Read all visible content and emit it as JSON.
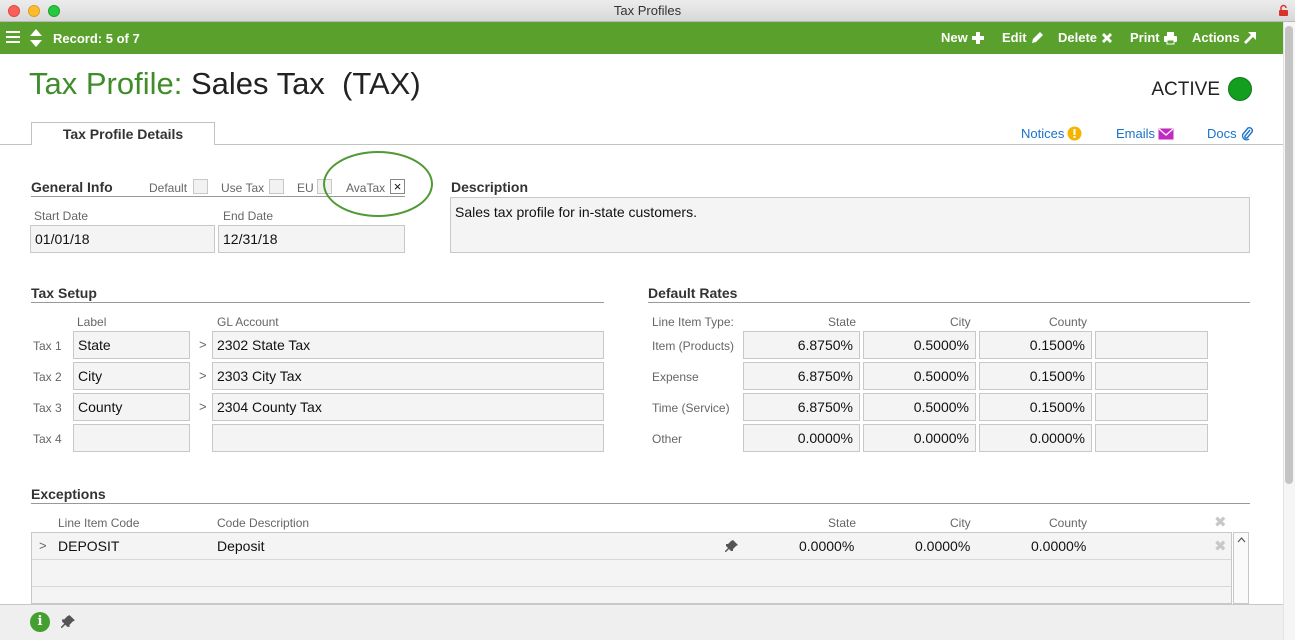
{
  "window": {
    "title": "Tax Profiles"
  },
  "toolbar": {
    "record": "Record: 5 of 7",
    "buttons": [
      {
        "label": "New",
        "icon": "plus-icon"
      },
      {
        "label": "Edit",
        "icon": "pencil-icon"
      },
      {
        "label": "Delete",
        "icon": "x-icon"
      },
      {
        "label": "Print",
        "icon": "printer-icon"
      },
      {
        "label": "Actions",
        "icon": "arrow-up-right-icon"
      }
    ]
  },
  "header": {
    "title_prefix": "Tax Profile:",
    "title": "Sales Tax  (TAX)",
    "status": "ACTIVE",
    "status_color": "#139e20"
  },
  "tabs": {
    "details": "Tax Profile Details"
  },
  "toplinks": {
    "notices": "Notices",
    "emails": "Emails",
    "docs": "Docs"
  },
  "general_info": {
    "heading": "General Info",
    "default_label": "Default",
    "default_checked": false,
    "use_tax_label": "Use Tax",
    "use_tax_checked": false,
    "eu_label": "EU",
    "eu_checked": false,
    "avatax_label": "AvaTax",
    "avatax_mark": "×",
    "start_date_label": "Start Date",
    "start_date": "01/01/18",
    "end_date_label": "End Date",
    "end_date": "12/31/18"
  },
  "description": {
    "heading": "Description",
    "text": "Sales tax profile for in-state customers."
  },
  "tax_setup": {
    "heading": "Tax Setup",
    "col_label": "Label",
    "col_gl": "GL Account",
    "rows": [
      {
        "tax": "Tax 1",
        "label": "State",
        "gl": "2302 State Tax",
        "arrow": ">"
      },
      {
        "tax": "Tax 2",
        "label": "City",
        "gl": "2303 City Tax",
        "arrow": ">"
      },
      {
        "tax": "Tax 3",
        "label": "County",
        "gl": "2304 County Tax",
        "arrow": ">"
      },
      {
        "tax": "Tax 4",
        "label": "",
        "gl": "",
        "arrow": ""
      }
    ]
  },
  "default_rates": {
    "heading": "Default Rates",
    "col_type": "Line Item Type:",
    "col_state": "State",
    "col_city": "City",
    "col_county": "County",
    "rows": [
      {
        "type": "Item (Products)",
        "state": "6.8750%",
        "city": "0.5000%",
        "county": "0.1500%"
      },
      {
        "type": "Expense",
        "state": "6.8750%",
        "city": "0.5000%",
        "county": "0.1500%"
      },
      {
        "type": "Time (Service)",
        "state": "6.8750%",
        "city": "0.5000%",
        "county": "0.1500%"
      },
      {
        "type": "Other",
        "state": "0.0000%",
        "city": "0.0000%",
        "county": "0.0000%"
      }
    ]
  },
  "exceptions": {
    "heading": "Exceptions",
    "col_code": "Line Item Code",
    "col_desc": "Code Description",
    "col_state": "State",
    "col_city": "City",
    "col_county": "County",
    "rows": [
      {
        "arrow": ">",
        "code": "DEPOSIT",
        "desc": "Deposit",
        "state": "0.0000%",
        "city": "0.0000%",
        "county": "0.0000%"
      }
    ]
  }
}
